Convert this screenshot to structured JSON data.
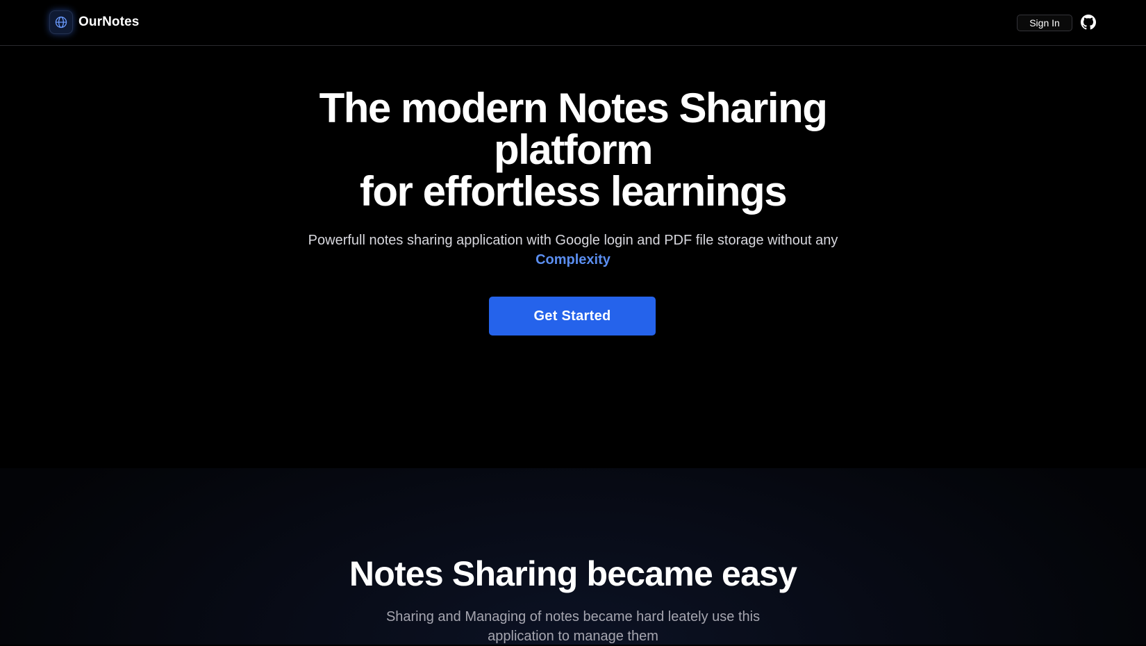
{
  "brand": {
    "name": "OurNotes",
    "icon": "globe-icon",
    "accent_color": "#5b8ef0"
  },
  "nav": {
    "signin_label": "Sign In",
    "github_icon": "github-icon"
  },
  "hero": {
    "title_line_1": "The modern Notes Sharing",
    "title_line_2": "platform",
    "title_line_3": "for effortless learnings",
    "subtitle": "Powerfull notes sharing application with Google login and PDF file storage without any",
    "subtitle_highlight": "Complexity",
    "cta_label": "Get Started",
    "cta_color": "#2563eb"
  },
  "features": {
    "title": "Notes Sharing became easy",
    "subtitle": "Sharing and Managing of notes became hard leately use this application to manage them"
  }
}
